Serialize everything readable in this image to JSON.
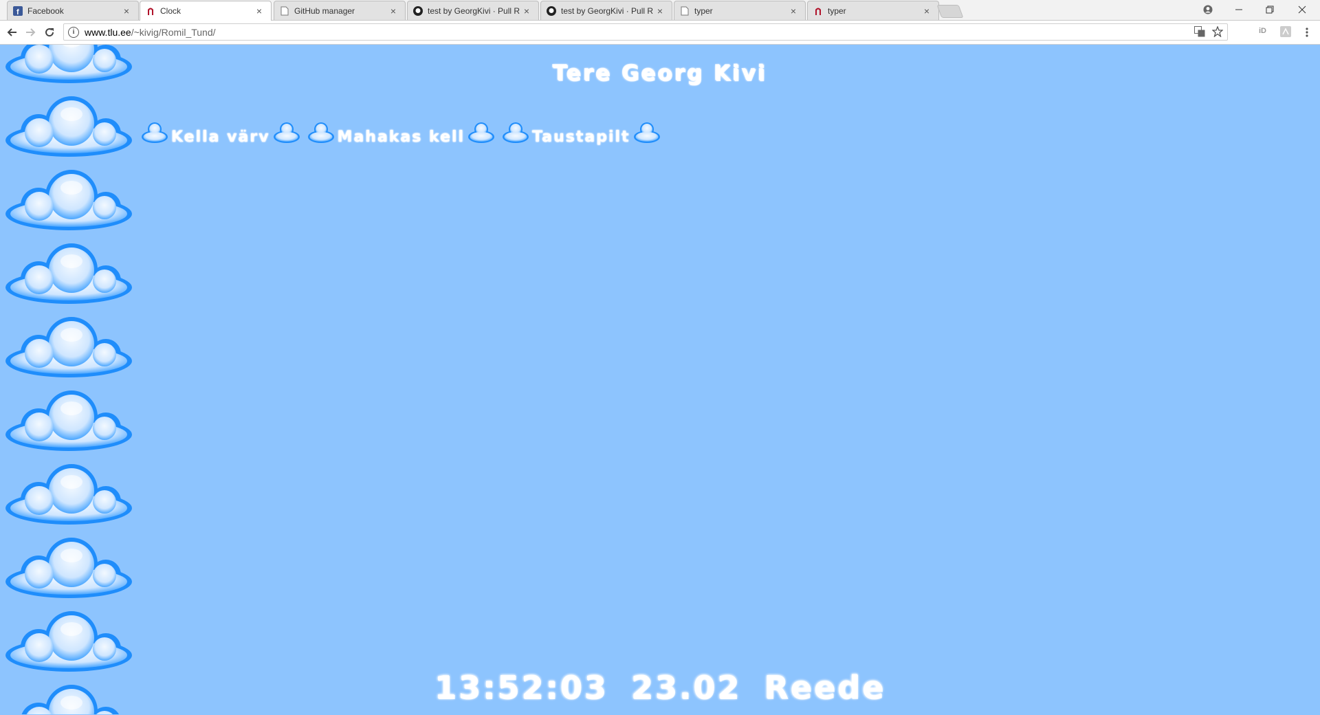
{
  "browser": {
    "tabs": [
      {
        "title": "Facebook",
        "icon": "facebook-icon",
        "active": false
      },
      {
        "title": "Clock",
        "icon": "tlu-icon",
        "active": true
      },
      {
        "title": "GitHub manager",
        "icon": "page-icon",
        "active": false
      },
      {
        "title": "test by GeorgKivi · Pull R",
        "icon": "github-icon",
        "active": false
      },
      {
        "title": "test by GeorgKivi · Pull R",
        "icon": "github-icon",
        "active": false
      },
      {
        "title": "typer",
        "icon": "page-icon",
        "active": false
      },
      {
        "title": "typer",
        "icon": "tlu-icon",
        "active": false
      }
    ],
    "close_glyph": "×",
    "url_host": "www.tlu.ee",
    "url_path": "/~kivig/Romil_Tund/",
    "extensions": [
      "iD"
    ]
  },
  "page": {
    "heading": "Tere Georg Kivi",
    "menu": [
      {
        "label": "Kella värv"
      },
      {
        "label": "Mahakas kell"
      },
      {
        "label": "Taustapilt"
      }
    ],
    "clock": {
      "time": "13:52:03",
      "date": "23.02",
      "day": "Reede"
    }
  },
  "colors": {
    "page_background": "#8dc4fe",
    "cloud_outline": "#1f8dfb",
    "cloud_fill": "#d8ecff",
    "text": "#ffffff"
  }
}
